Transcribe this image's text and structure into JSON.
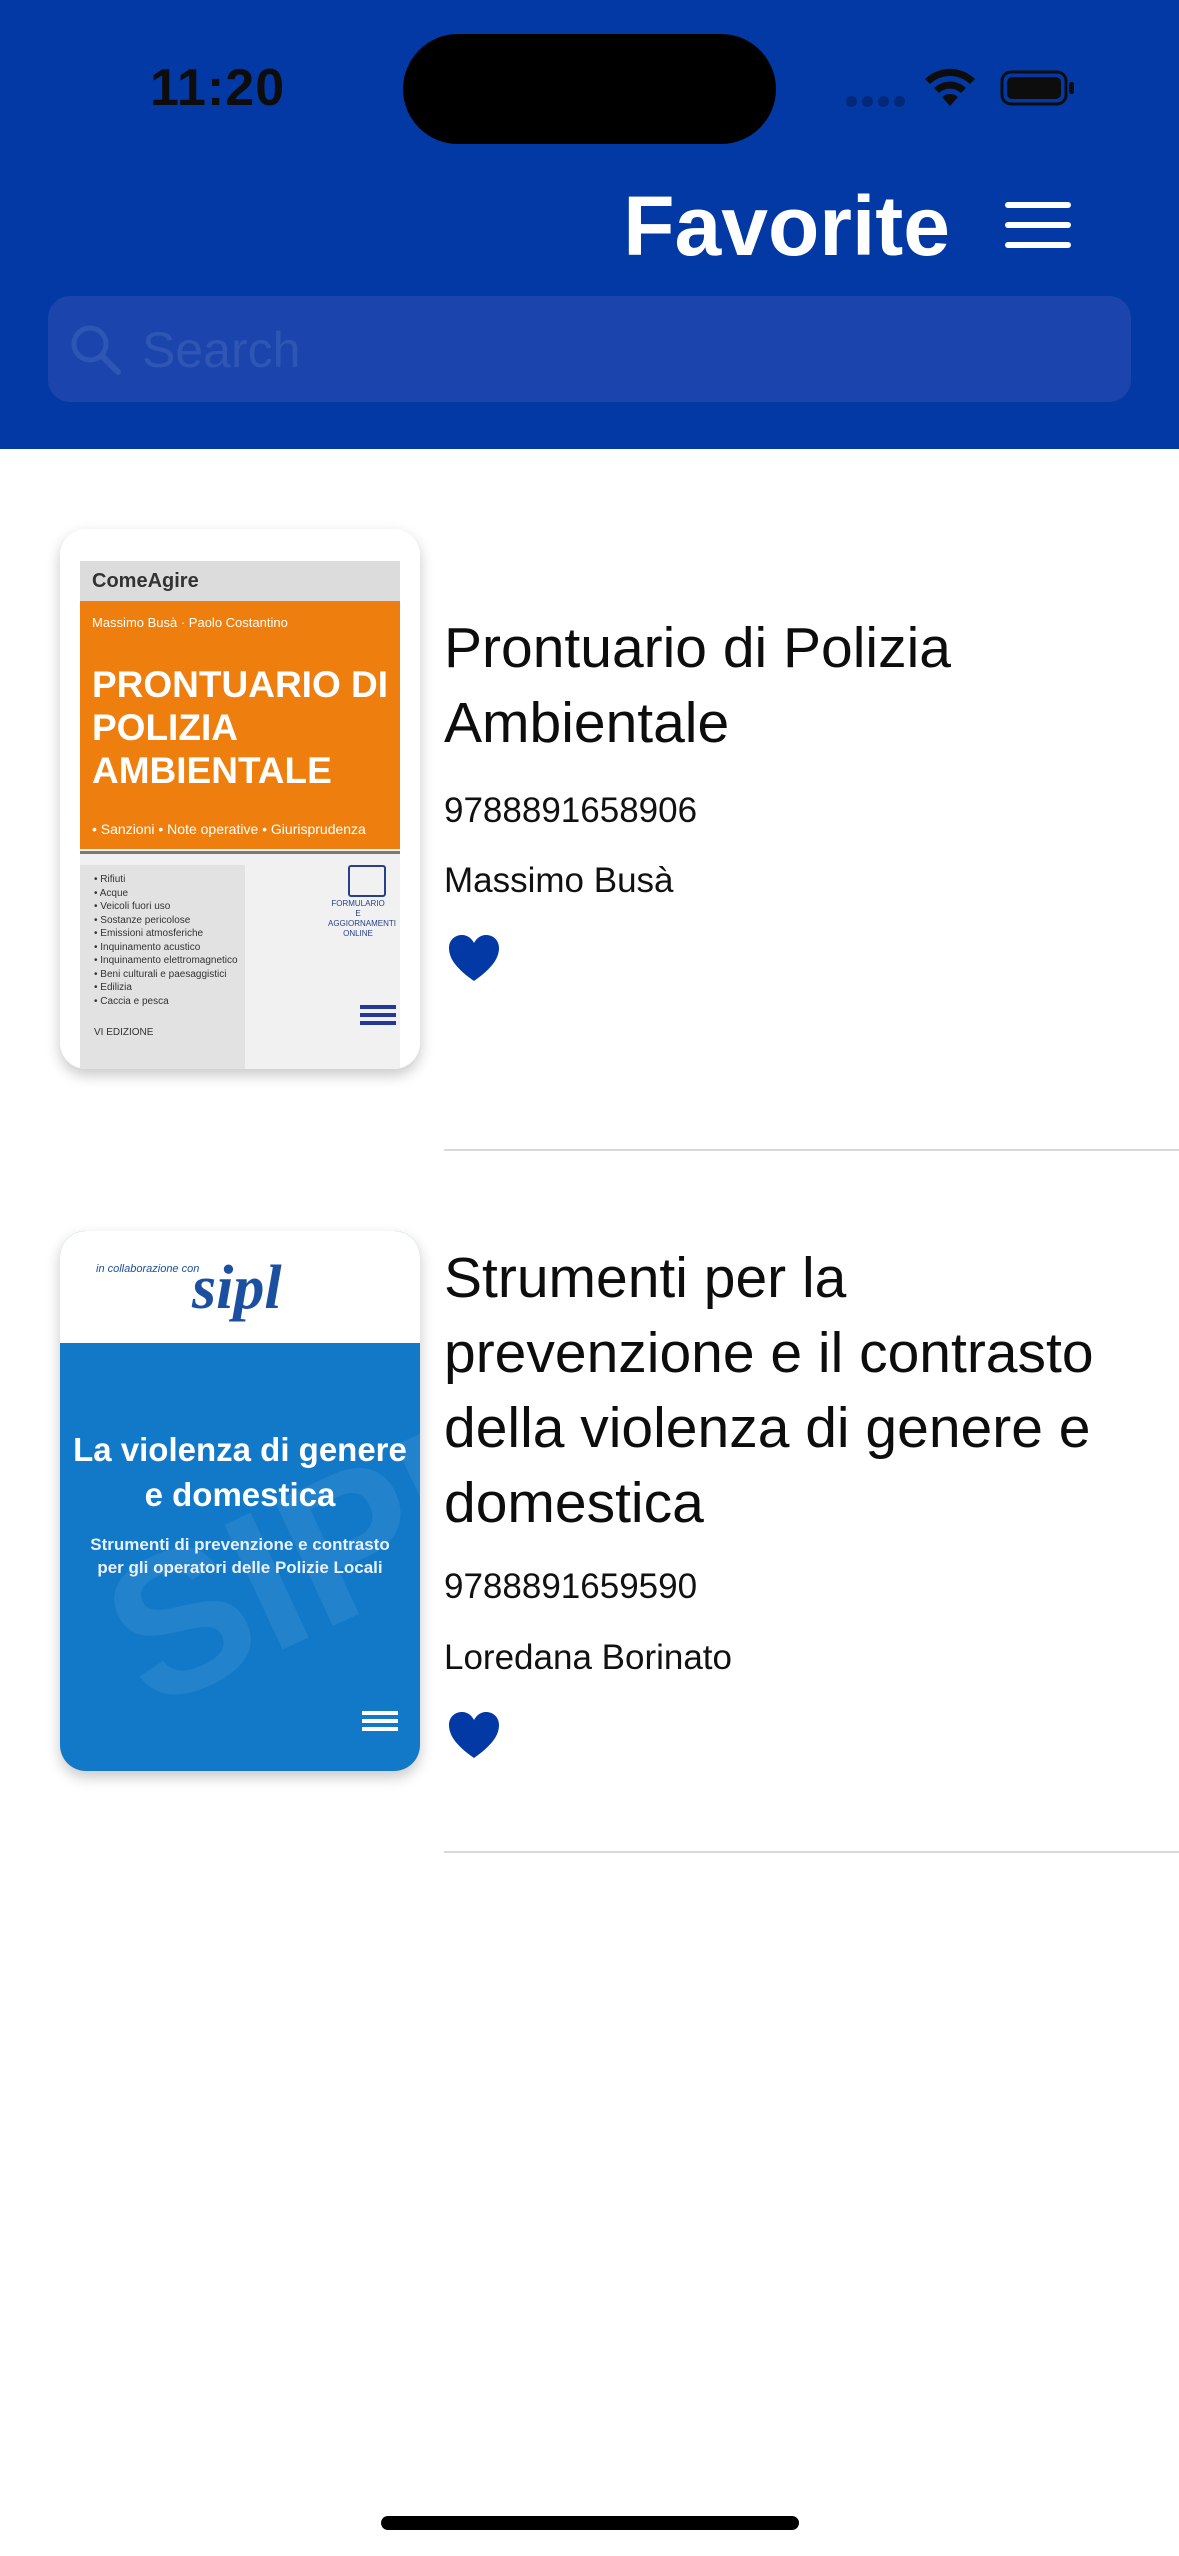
{
  "status_bar": {
    "time": "11:20"
  },
  "header": {
    "title": "Favorite",
    "background": "#0339a5"
  },
  "search": {
    "placeholder": "Search"
  },
  "favorites": [
    {
      "title": "Prontuario di Polizia Ambientale",
      "isbn": "9788891658906",
      "author": "Massimo Busà",
      "favorite": true,
      "cover": {
        "series": "ComeAgire",
        "authors": "Massimo Busà · Paolo Costantino",
        "title": "PRONTUARIO DI POLIZIA AMBIENTALE",
        "tags": "• Sanzioni  • Note operative  • Giurisprudenza",
        "topics": "• Rifiuti\n• Acque\n• Veicoli fuori uso\n• Sostanze pericolose\n• Emissioni atmosferiche\n• Inquinamento acustico\n• Inquinamento elettromagnetico\n• Beni culturali e paesaggistici\n• Edilizia\n• Caccia e pesca",
        "edition": "VI EDIZIONE",
        "online": "FORMULARIO E AGGIORNAMENTI ONLINE",
        "color": "#ee7f0f"
      }
    },
    {
      "title": "Strumenti per la prevenzione e il contrasto della violenza di genere e domestica",
      "isbn": "9788891659590",
      "author": "Loredana Borinato",
      "favorite": true,
      "cover": {
        "collab": "in collaborazione con",
        "logo": "sipl",
        "title": "La violenza di genere e domestica",
        "subtitle": "Strumenti di prevenzione e contrasto per gli operatori delle Polizie Locali",
        "color": "#1279c9"
      }
    }
  ],
  "accent_color": "#0339a5"
}
